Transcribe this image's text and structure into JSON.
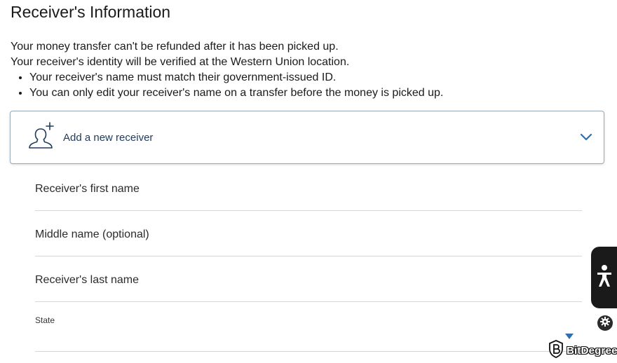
{
  "page": {
    "title": "Receiver's Information"
  },
  "notice": {
    "line1": "Your money transfer can't be refunded after it has been picked up.",
    "line2": "Your receiver's identity will be verified at the Western Union location.",
    "bullets": [
      "Your receiver's name must match their government-issued ID.",
      "You can only edit your receiver's name on a transfer before the money is picked up."
    ]
  },
  "receiver_card": {
    "label": "Add a new receiver",
    "icon": "add-person-icon",
    "expand_icon": "chevron-down-icon"
  },
  "form": {
    "first_name_label": "Receiver's first name",
    "middle_name_label": "Middle name (optional)",
    "last_name_label": "Receiver's last name",
    "state_label": "State"
  },
  "widgets": {
    "accessibility_icon": "accessibility-person-icon",
    "settings_icon": "gear-icon"
  },
  "watermark": {
    "text": "BitDegree"
  },
  "colors": {
    "text": "#1a1a1a",
    "card_label": "#1f3a5a",
    "accent_blue": "#2e6fb0",
    "card_border": "#9aa9b8",
    "divider": "#d6d6d6"
  }
}
